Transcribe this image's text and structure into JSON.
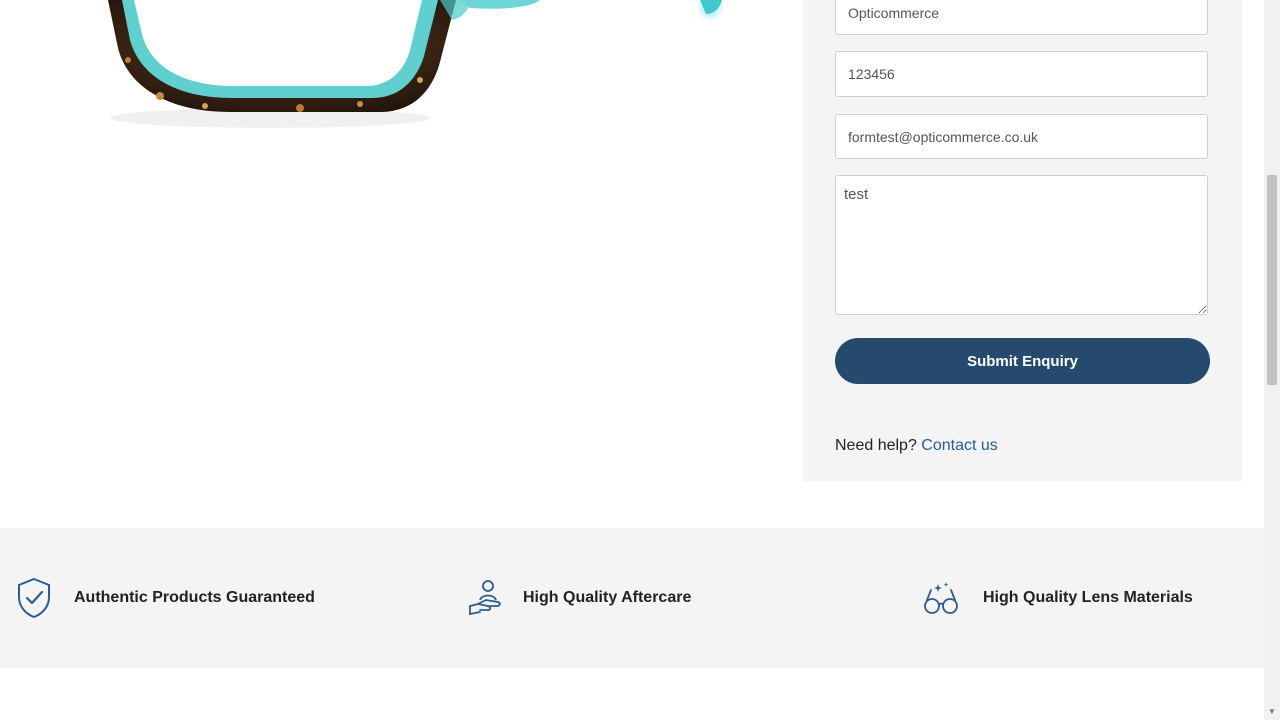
{
  "form": {
    "company_value": "Opticommerce",
    "phone_value": "123456",
    "email_value": "formtest@opticommerce.co.uk",
    "message_value": "test",
    "submit_label": "Submit Enquiry",
    "help_text": "Need help?",
    "help_link": "Contact us"
  },
  "features": [
    {
      "label": "Authentic Products Guaranteed",
      "icon": "shield-check-icon"
    },
    {
      "label": "High Quality Aftercare",
      "icon": "hand-care-icon"
    },
    {
      "label": "High Quality Lens Materials",
      "icon": "glasses-sparkle-icon"
    }
  ],
  "colors": {
    "accent": "#264a6e",
    "link": "#2b5b8f",
    "panel_bg": "#f4f4f4",
    "frame_tortoise": "#3a2414",
    "frame_turquoise": "#5fd0d0"
  }
}
